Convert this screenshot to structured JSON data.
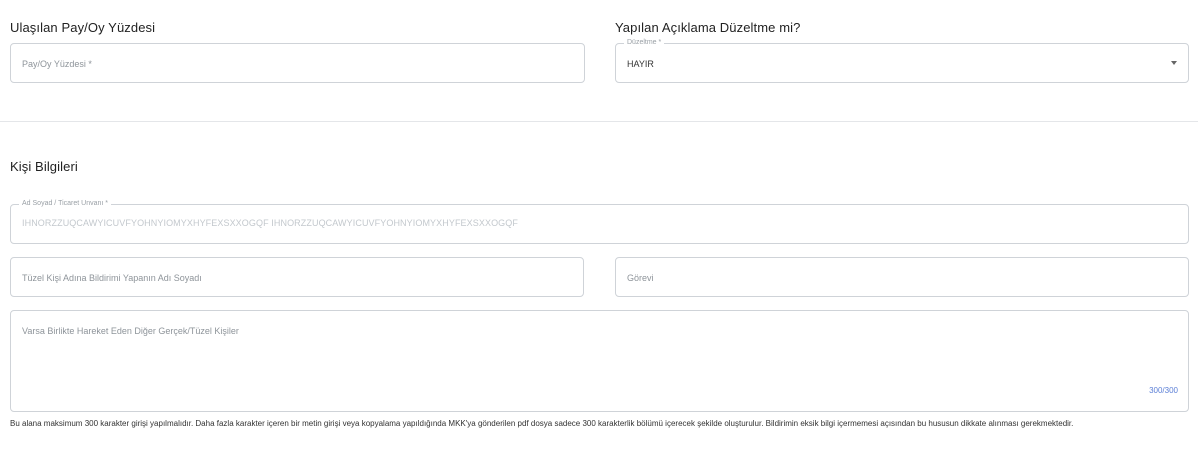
{
  "percent_section": {
    "title": "Ulaşılan Pay/Oy Yüzdesi",
    "input_placeholder": "Pay/Oy Yüzdesi *"
  },
  "correction_section": {
    "title": "Yapılan Açıklama Düzeltme mi?",
    "select_label": "Düzeltme *",
    "select_value": "HAYIR"
  },
  "person_section": {
    "title": "Kişi Bilgileri",
    "name_label": "Ad Soyad / Ticaret Unvanı *",
    "name_value": "IHNORZZUQCAWYICUVFYOHNYIOMYXHYFEXSXXOGQF IHNORZZUQCAWYICUVFYOHNYIOMYXHYFEXSXXOGQF",
    "legal_person_placeholder": "Tüzel Kişi Adına Bildirimi Yapanın Adı Soyadı",
    "role_placeholder": "Görevi",
    "others_placeholder": "Varsa Birlikte Hareket Eden Diğer Gerçek/Tüzel Kişiler",
    "counter": "300/300",
    "helper_text": "Bu alana maksimum 300 karakter girişi yapılmalıdır. Daha fazla karakter içeren bir metin girişi veya kopyalama yapıldığında MKK'ya gönderilen pdf dosya sadece 300 karakterlik bölümü içerecek şekilde oluşturulur. Bildirimin eksik bilgi içermemesi açısından bu hususun dikkate alınması gerekmektedir."
  }
}
